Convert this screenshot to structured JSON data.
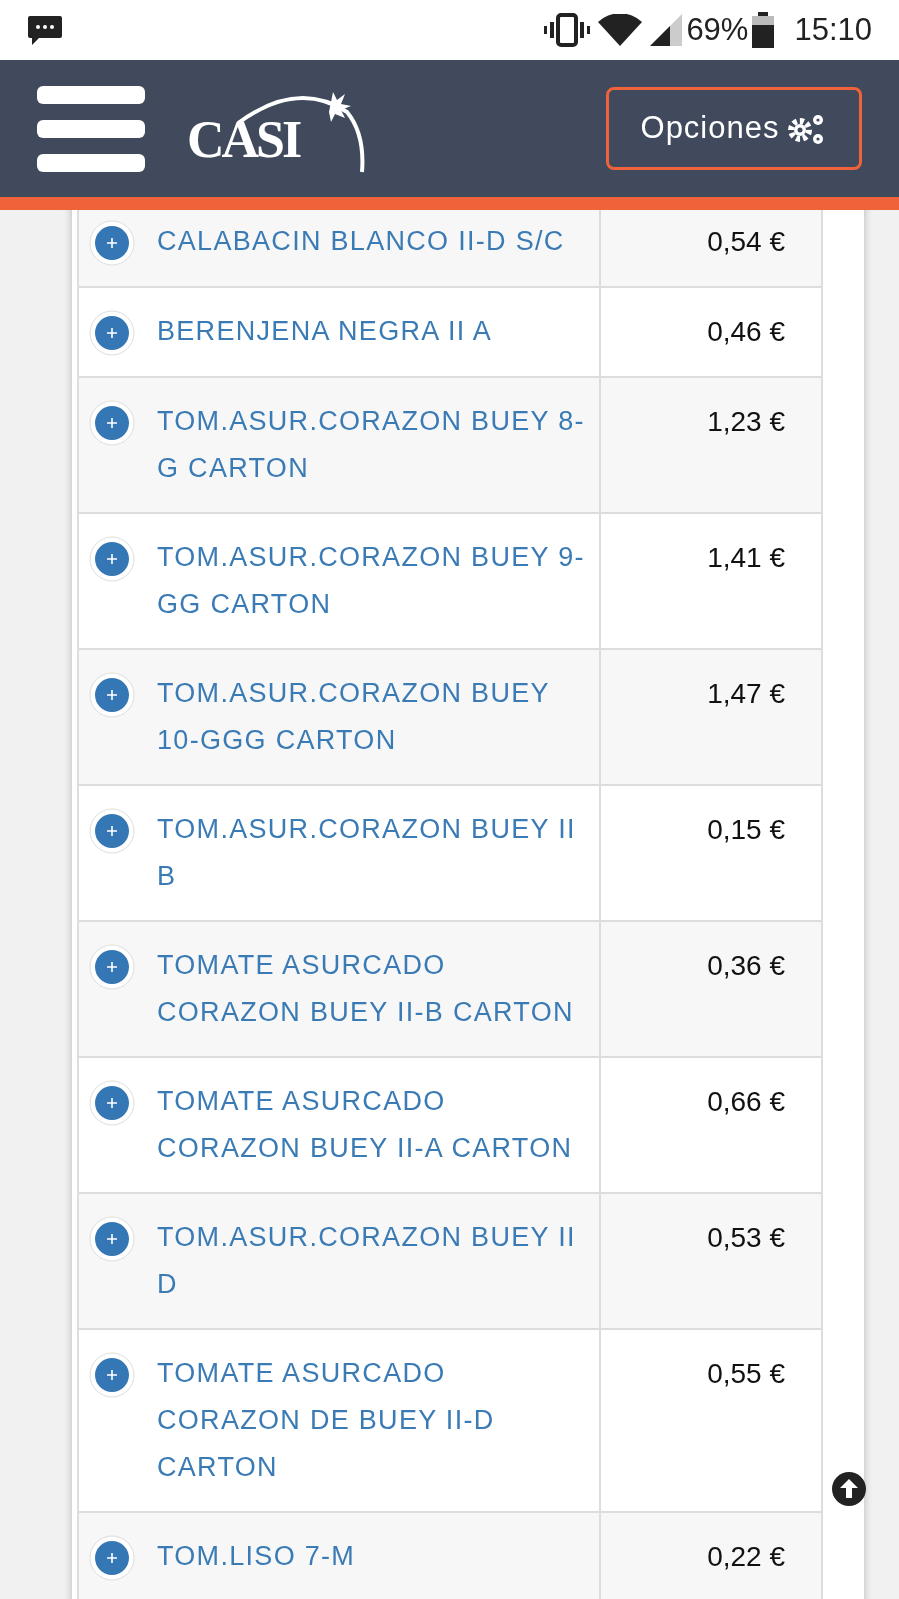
{
  "status_bar": {
    "battery": "69%",
    "time": "15:10"
  },
  "header": {
    "logo": "CASI",
    "options_button": "Opciones"
  },
  "table": {
    "rows": [
      {
        "product": "CALABACIN BLANCO II-D S/C",
        "price": "0,54 €"
      },
      {
        "product": "BERENJENA NEGRA II A",
        "price": "0,46 €"
      },
      {
        "product": "TOM.ASUR.CORAZON BUEY 8-G CARTON",
        "price": "1,23 €"
      },
      {
        "product": "TOM.ASUR.CORAZON BUEY 9-GG CARTON",
        "price": "1,41 €"
      },
      {
        "product": "TOM.ASUR.CORAZON BUEY 10-GGG CARTON",
        "price": "1,47 €"
      },
      {
        "product": "TOM.ASUR.CORAZON BUEY II B",
        "price": "0,15 €"
      },
      {
        "product": "TOMATE ASURCADO CORAZON BUEY II-B CARTON",
        "price": "0,36 €"
      },
      {
        "product": "TOMATE ASURCADO CORAZON BUEY II-A CARTON",
        "price": "0,66 €"
      },
      {
        "product": "TOM.ASUR.CORAZON BUEY II D",
        "price": "0,53 €"
      },
      {
        "product": "TOMATE ASURCADO CORAZON DE BUEY II-D CARTON",
        "price": "0,55 €"
      },
      {
        "product": "TOM.LISO 7-M",
        "price": "0,22 €"
      }
    ]
  }
}
